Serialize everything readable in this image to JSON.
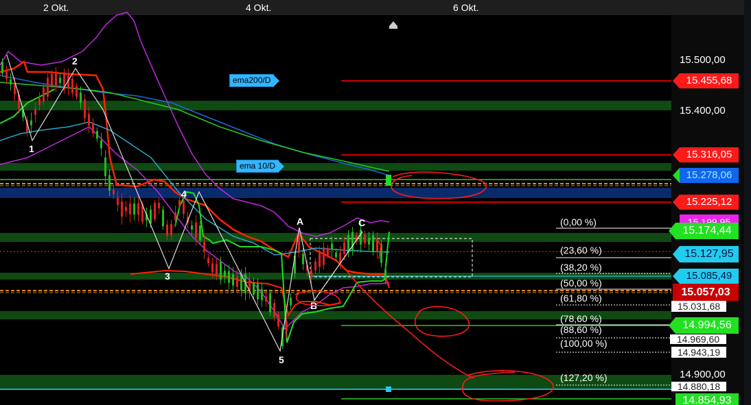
{
  "x_axis": {
    "labels": [
      "2 Okt.",
      "4 Okt.",
      "6 Okt."
    ]
  },
  "price_axis": {
    "grid_labels": [
      "15.500,00",
      "15.400,00",
      "14.900,00"
    ]
  },
  "markers": {
    "ema200": "ema200/D",
    "ema10": "ema 10/D"
  },
  "price_tags": {
    "red_1": "15.455,68",
    "red_2": "15.316,05",
    "blue_1": "15.278,06",
    "red_3": "15.225,12",
    "magenta_partial": "15.199,95",
    "green_1": "15.174,44",
    "cyan_1": "15.127,95",
    "cyan_2": "15.085,49",
    "current": "15.057,03",
    "white_1": "15.031,68",
    "green_2": "14.994,56",
    "white_2": "14.969,60",
    "white_3": "14.943,19",
    "white_4": "14.880,18",
    "green_3": "14.854,93"
  },
  "fib_labels": [
    "(0,00 %)",
    "(23,60 %)",
    "(38,20 %)",
    "(50,00 %)",
    "(61,80 %)",
    "(78,60 %)",
    "(88,60 %)",
    "(100,00 %)",
    "(127,20 %)"
  ],
  "wave_labels": [
    "1",
    "2",
    "3",
    "4",
    "5",
    "A",
    "B",
    "C"
  ],
  "colors": {
    "background": "#000000",
    "zone_green": "#0f4a12",
    "zone_blue": "#0a2b6b",
    "ema_red": "#ff2200",
    "band_purple": "#cc22ee",
    "line_green": "#22dd22",
    "line_blue": "#2266dd",
    "line_cyan": "#22aacc",
    "candle_up": "#22bb22",
    "candle_down": "#dd2222",
    "annotation_red": "#ff1a1a",
    "tag_red": "#ff1a1a",
    "tag_green": "#22e022",
    "tag_cyan": "#22ccee",
    "tag_blue": "#1166ee",
    "tag_current": "#c80000",
    "tag_magenta": "#ee22ee"
  },
  "chart_data": {
    "type": "candlestick",
    "x_ticks": [
      "2 Okt.",
      "4 Okt.",
      "6 Okt."
    ],
    "ylim": [
      14840,
      15540
    ],
    "y_grid": [
      15500,
      15400,
      14900
    ],
    "current_price": 15057.03,
    "wave_points": [
      {
        "label": "1",
        "x": "1 Okt.",
        "y": 15300
      },
      {
        "label": "2",
        "x": "2 Okt.",
        "y": 15420
      },
      {
        "label": "3",
        "x": "3 Okt.",
        "y": 15090
      },
      {
        "label": "4",
        "x": "3 Okt.",
        "y": 15245
      },
      {
        "label": "5",
        "x": "4 Okt.",
        "y": 14930
      },
      {
        "label": "A",
        "x": "4 Okt.",
        "y": 15170
      },
      {
        "label": "B",
        "x": "4 Okt.",
        "y": 15055
      },
      {
        "label": "C",
        "x": "5 Okt.",
        "y": 15170
      }
    ],
    "fibonacci": [
      {
        "label": "(0,00 %)",
        "value": 15174.44
      },
      {
        "label": "(23,60 %)",
        "value": 15127.95
      },
      {
        "label": "(38,20 %)",
        "value": 15085.49
      },
      {
        "label": "(50,00 %)",
        "value": 15057.03
      },
      {
        "label": "(61,80 %)",
        "value": 15031.68
      },
      {
        "label": "(78,60 %)",
        "value": 14994.56
      },
      {
        "label": "(88,60 %)",
        "value": 14969.6
      },
      {
        "label": "(100,00 %)",
        "value": 14943.19
      },
      {
        "label": "(127,20 %)",
        "value": 14880.18
      }
    ],
    "horizontal_levels": [
      {
        "value": 15455.68,
        "color": "red"
      },
      {
        "value": 15316.05,
        "color": "red"
      },
      {
        "value": 15278.06,
        "color": "blue"
      },
      {
        "value": 15225.12,
        "color": "red"
      },
      {
        "value": 15174.44,
        "color": "green"
      },
      {
        "value": 14994.56,
        "color": "green"
      },
      {
        "value": 14854.93,
        "color": "green"
      }
    ],
    "series": [
      {
        "name": "ema200/D"
      },
      {
        "name": "ema 10/D"
      }
    ]
  }
}
